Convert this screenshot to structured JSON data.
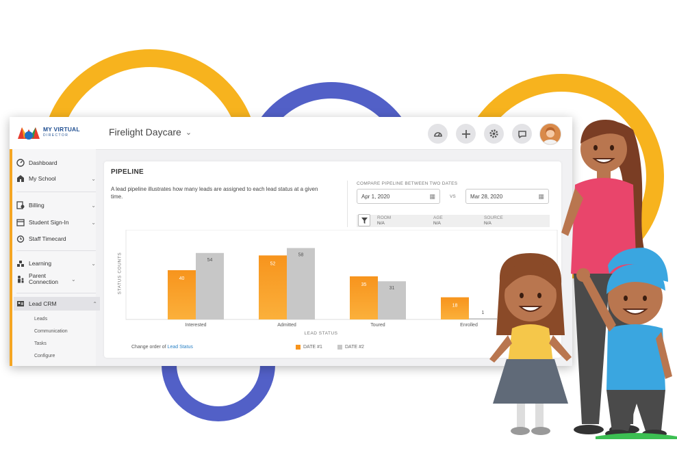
{
  "colors": {
    "accent": "#f5a623",
    "ring_orange": "#f7b31e",
    "ring_blue": "#5260c7",
    "bar1_top": "#f7941d",
    "bar1_bottom": "#fbb03b",
    "bar2": "#c7c7c7",
    "link": "#2b82c5"
  },
  "brand": {
    "line1": "MY VIRTUAL",
    "line2": "DIRECTOR"
  },
  "header": {
    "org_name": "Firelight Daycare",
    "icons": [
      "dashboard-icon",
      "plus-icon",
      "gear-icon",
      "chat-icon",
      "user-avatar"
    ]
  },
  "sidebar": {
    "items": [
      {
        "label": "Dashboard",
        "icon": "dashboard-icon",
        "has_chevron": false
      },
      {
        "label": "My School",
        "icon": "school-icon",
        "has_chevron": true
      },
      {
        "label": "Billing",
        "icon": "billing-icon",
        "has_chevron": true
      },
      {
        "label": "Student Sign-In",
        "icon": "calendar-icon",
        "has_chevron": true
      },
      {
        "label": "Staff Timecard",
        "icon": "clock-icon",
        "has_chevron": false
      },
      {
        "label": "Learning",
        "icon": "learning-icon",
        "has_chevron": true
      },
      {
        "label": "Parent Connection",
        "icon": "parent-icon",
        "has_chevron": true
      },
      {
        "label": "Lead CRM",
        "icon": "crm-icon",
        "has_chevron": true,
        "expanded": true
      }
    ],
    "subitems": [
      "Leads",
      "Communication",
      "Tasks",
      "Configure"
    ]
  },
  "pipeline": {
    "title": "PIPELINE",
    "description": "A lead pipeline illustrates how many leads are assigned to each lead status at a given time.",
    "compare_label": "COMPARE PIPELINE BETWEEN TWO DATES",
    "date1": "Apr 1, 2020",
    "vs": "VS",
    "date2": "Mar 28, 2020",
    "filters": [
      {
        "label": "ROOM",
        "value": "N/A"
      },
      {
        "label": "AGE",
        "value": "N/A"
      },
      {
        "label": "SOURCE",
        "value": "N/A"
      }
    ],
    "footer_text": "Change order of",
    "footer_link": "Lead Status"
  },
  "chart_data": {
    "type": "bar",
    "categories": [
      "Interested",
      "Admitted",
      "Toured",
      "Enrolled"
    ],
    "series": [
      {
        "name": "DATE #1",
        "values": [
          40,
          52,
          35,
          18
        ]
      },
      {
        "name": "DATE #2",
        "values": [
          54,
          58,
          31,
          1
        ]
      }
    ],
    "xlabel": "LEAD STATUS",
    "ylabel": "STATUS COUNTS",
    "ylim": [
      0,
      70
    ],
    "grid": false,
    "legend": "bottom"
  }
}
